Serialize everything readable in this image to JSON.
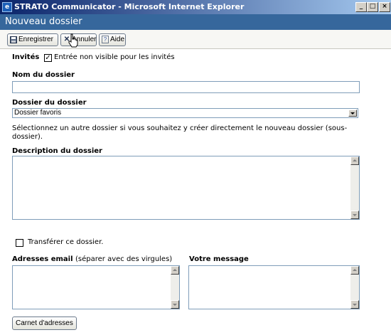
{
  "window": {
    "title": "STRATO Communicator - Microsoft Internet Explorer",
    "minimize_glyph": "_",
    "maximize_glyph": "□",
    "close_glyph": "×"
  },
  "header": {
    "title": "Nouveau dossier"
  },
  "toolbar": {
    "save_label": "Enregistrer",
    "cancel_label": "Annuler",
    "help_label": "Aide"
  },
  "form": {
    "guests_label": "Invités",
    "guests_checkbox_label": "Entrée non visible pour les invités",
    "guests_checked": true,
    "folder_name_label": "Nom du dossier",
    "folder_name_value": "",
    "parent_folder_label": "Dossier du dossier",
    "parent_folder_selected": "Dossier favoris",
    "parent_folder_hint": "Sélectionnez un autre dossier si vous souhaitez y créer directement le nouveau dossier (sous-",
    "parent_folder_hint_cont": "dossier).",
    "description_label": "Description du dossier",
    "description_value": "",
    "transfer_label": "Transférer ce dossier.",
    "transfer_checked": false,
    "emails_label": "Adresses email",
    "emails_hint": "(séparer avec des virgules)",
    "message_label": "Votre message",
    "address_book_label": "Carnet d'adresses"
  },
  "icons": {
    "save": "floppy-icon",
    "cancel": "x-icon",
    "help": "question-icon",
    "checkmark": "✓"
  }
}
